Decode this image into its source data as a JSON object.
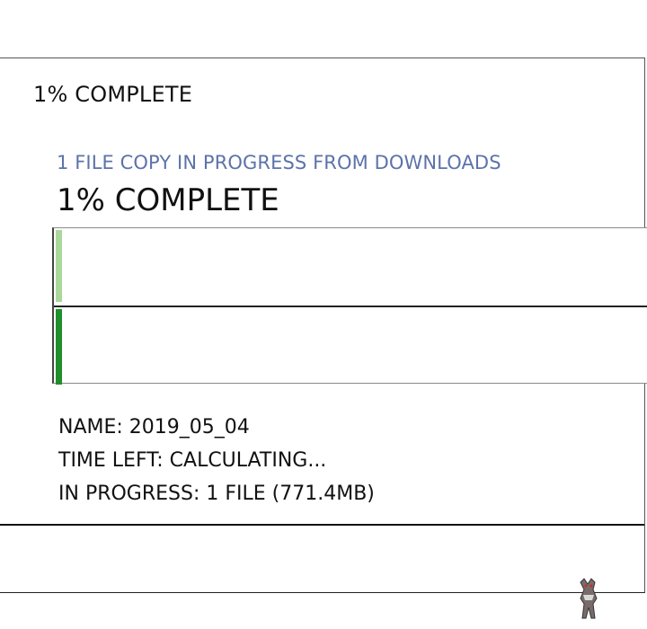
{
  "window": {
    "title": "1% COMPLETE"
  },
  "progress": {
    "subtitle": "1 FILE COPY IN PROGRESS FROM DOWNLOADS",
    "percent_label": "1% COMPLETE",
    "percent_value": 1
  },
  "details": {
    "name": "NAME: 2019_05_04",
    "time_left": "TIME LEFT: CALCULATING...",
    "in_progress": "IN PROGRESS: 1 FILE (771.4MB)"
  },
  "colors": {
    "subtitle": "#5c73aa",
    "progress_light": "#a9d89a",
    "progress_dark": "#1f8f2c"
  }
}
